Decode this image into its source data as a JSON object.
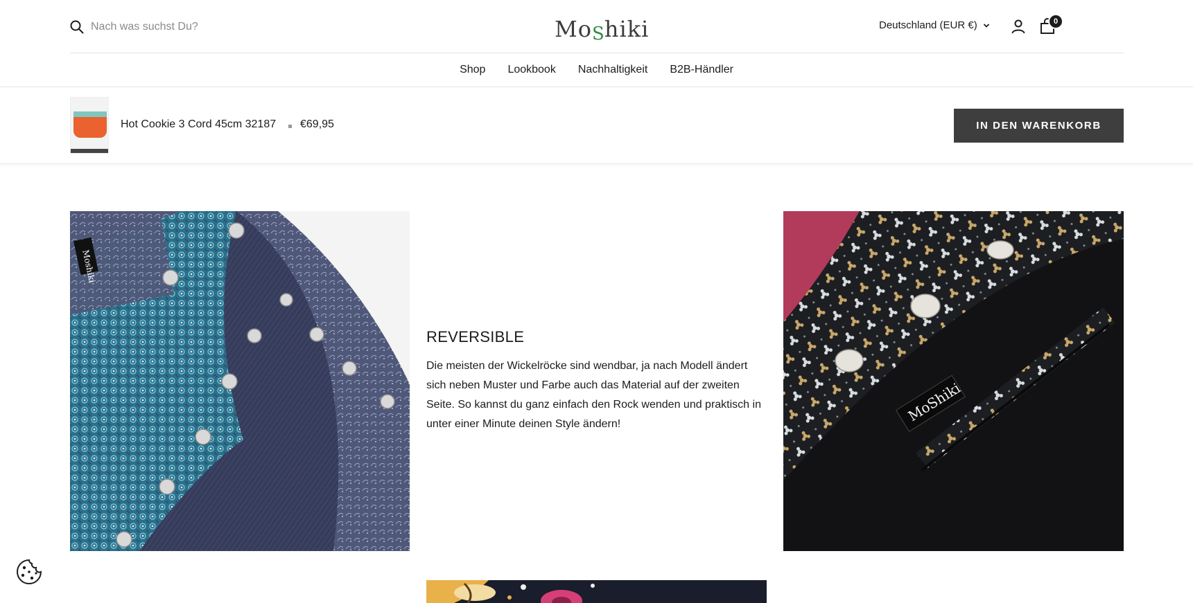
{
  "header": {
    "search": {
      "placeholder": "Nach was suchst Du?",
      "value": ""
    },
    "logo": {
      "part1": "Mo",
      "part2": "S",
      "part3": "hiki"
    },
    "country_selector": "Deutschland (EUR €)",
    "cart_count": "0",
    "icons": {
      "search": "search-icon",
      "account": "user-icon",
      "cart": "cart-icon",
      "dropdown": "chevron-down-icon"
    }
  },
  "nav": {
    "items": [
      "Shop",
      "Lookbook",
      "Nachhaltigkeit",
      "B2B-Händler"
    ]
  },
  "sticky_bar": {
    "product_title": "Hot Cookie 3 Cord 45cm 32187",
    "price": "€69,95",
    "add_to_cart_label": "IN DEN WARENKORB"
  },
  "feature": {
    "title": "REVERSIBLE",
    "text": "Die meisten der Wickelröcke sind wendbar, ja nach Modell ändert sich neben Muster und Farbe auch das Material auf der zweiten Seite. So kannst du ganz einfach den Rock wenden und praktisch in unter einer Minute deinen Style ändern!"
  },
  "image_labels": {
    "left_tag": "Moshiki",
    "right_tag": "MoShiki"
  },
  "cookie_button": {
    "icon": "cookie-icon"
  },
  "colors": {
    "button_bg": "#3e3e3e",
    "logo_accent": "#2f8a3c",
    "text": "#1c1c1c"
  }
}
